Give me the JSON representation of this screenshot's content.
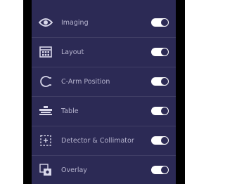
{
  "theme": {
    "panel_bg": "#2c2a55",
    "label_color": "#b7b5cf",
    "toggle_color": "#ffffff"
  },
  "settings": {
    "items": [
      {
        "label": "Imaging",
        "icon": "eye-icon",
        "enabled": true
      },
      {
        "label": "Layout",
        "icon": "grid-layout-icon",
        "enabled": true
      },
      {
        "label": "C-Arm Position",
        "icon": "c-arm-icon",
        "enabled": true
      },
      {
        "label": "Table",
        "icon": "table-icon",
        "enabled": true
      },
      {
        "label": "Detector & Collimator",
        "icon": "detector-collimator-icon",
        "enabled": true
      },
      {
        "label": "Overlay",
        "icon": "overlay-icon",
        "enabled": true
      }
    ]
  }
}
